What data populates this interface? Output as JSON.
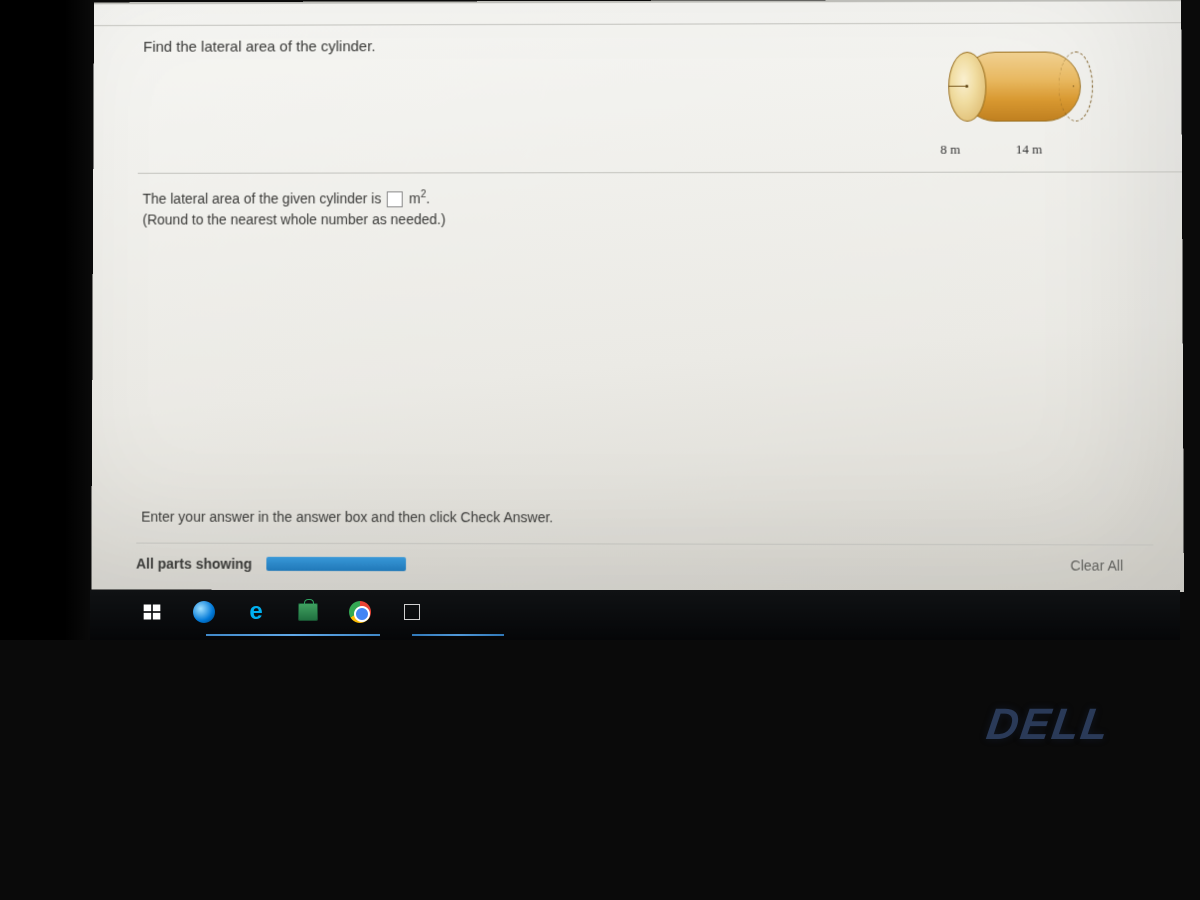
{
  "question": {
    "prompt": "Find the lateral area of the cylinder."
  },
  "diagram": {
    "radius_label": "8 m",
    "length_label": "14 m"
  },
  "answer_section": {
    "prefix": "The lateral area of the given cylinder is",
    "unit_base": "m",
    "unit_exp": "2",
    "unit_suffix": ".",
    "round_hint": "(Round to the nearest whole number as needed.)"
  },
  "footer": {
    "instruction": "Enter your answer in the answer box and then click Check Answer.",
    "parts_label": "All parts showing",
    "clear_label": "Clear All"
  },
  "brand": {
    "laptop": "DELL"
  }
}
